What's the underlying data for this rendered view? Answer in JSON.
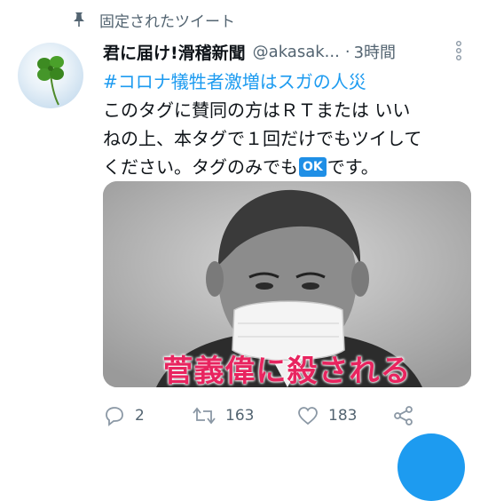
{
  "pinned": {
    "label": "固定されたツイート"
  },
  "tweet": {
    "author_name": "君に届け!滑稽新聞",
    "handle": "@akasak...",
    "separator": "·",
    "time": "3時間",
    "hashtag": "#コロナ犠牲者激増はスガの人災",
    "line1": "このタグに賛同の方はＲＴまたは いい",
    "line2": "ねの上、本タグで１回だけでもツイして",
    "line3_pre": "ください。タグのみでも",
    "ok_badge": "OK",
    "line3_post": "です。",
    "image_caption": "菅義偉に殺される"
  },
  "actions": {
    "replies": "2",
    "retweets": "163",
    "likes": "183"
  },
  "colors": {
    "accent": "#1d9bf0",
    "caption": "#e8245f",
    "muted": "#536471"
  }
}
